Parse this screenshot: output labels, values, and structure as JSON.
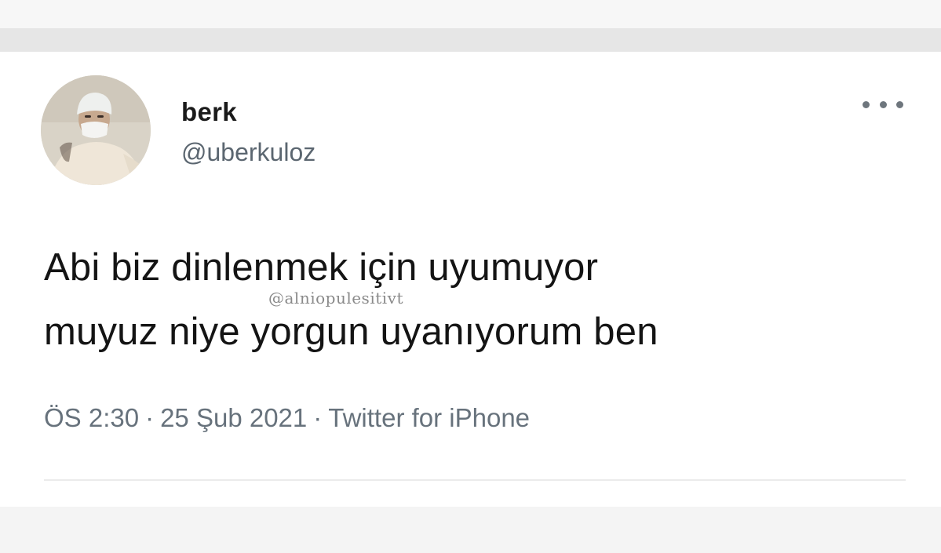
{
  "user": {
    "display_name": "berk",
    "handle": "@uberkuloz"
  },
  "tweet": {
    "text_lines": [
      "Abi biz dinlenmek için uyumuyor",
      "muyuz niye yorgun uyanıyorum ben"
    ],
    "time": "ÖS 2:30",
    "date": "25 Şub 2021",
    "source": "Twitter for iPhone",
    "separator": "·"
  },
  "watermark": "@alniopulesitivt",
  "icons": {
    "more": "more-horizontal-icon",
    "avatar": "profile-photo"
  },
  "colors": {
    "text": "#141414",
    "secondary": "#67727c",
    "card": "#ffffff",
    "strip": "#e6e6e6"
  }
}
